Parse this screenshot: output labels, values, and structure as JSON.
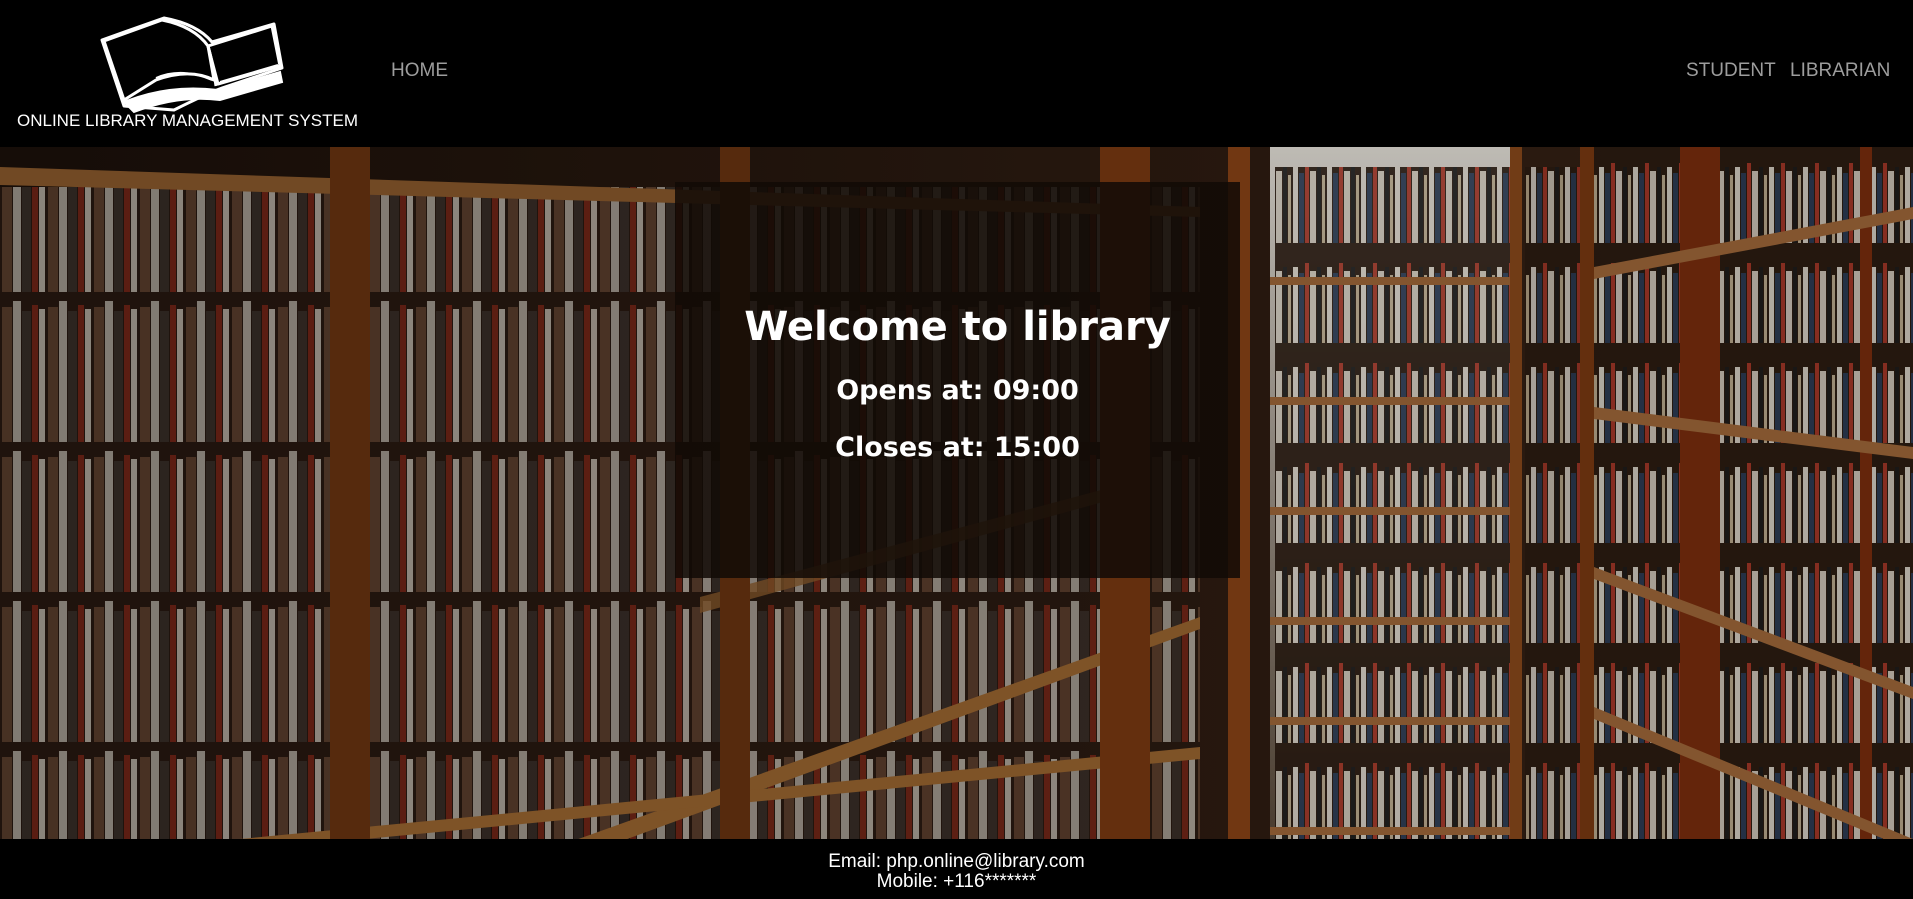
{
  "header": {
    "site_title": "ONLINE LIBRARY MANAGEMENT SYSTEM",
    "logo_icon": "open-book-icon",
    "nav_left": [
      {
        "label": "HOME"
      }
    ],
    "nav_right": [
      {
        "label": "STUDENT"
      },
      {
        "label": "LIBRARIAN"
      }
    ]
  },
  "hero": {
    "background": "library-bookshelves-photo",
    "welcome_title": "Welcome to library",
    "opens_text": "Opens at: 09:00",
    "closes_text": "Closes at: 15:00"
  },
  "footer": {
    "email_text": "Email: php.online@library.com",
    "mobile_text": "Mobile: +116*******"
  },
  "colors": {
    "header_bg": "#000000",
    "nav_text": "#9d9d9d",
    "title_text": "#ffffff",
    "overlay_box": "#120a06",
    "footer_bg": "#000000"
  }
}
